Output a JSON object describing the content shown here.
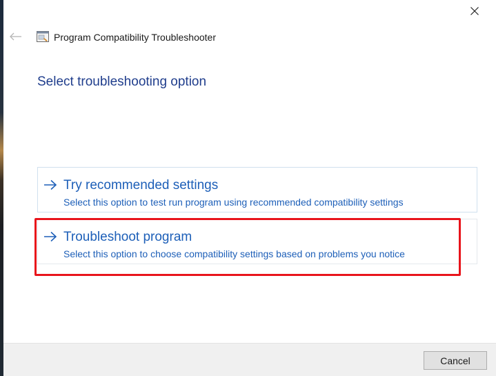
{
  "window": {
    "title": "Program Compatibility Troubleshooter",
    "close_icon": "close-icon",
    "back_icon": "back-arrow-icon",
    "app_icon": "troubleshooter-app-icon"
  },
  "page": {
    "heading": "Select troubleshooting option"
  },
  "options": [
    {
      "icon": "arrow-right-icon",
      "title": "Try recommended settings",
      "description": "Select this option to test run program using recommended compatibility settings"
    },
    {
      "icon": "arrow-right-icon",
      "title": "Troubleshoot program",
      "description": "Select this option to choose compatibility settings based on problems you notice",
      "highlighted": true
    }
  ],
  "footer": {
    "cancel_label": "Cancel"
  },
  "colors": {
    "accent_link": "#1d5fb8",
    "heading": "#1f3d8c",
    "highlight": "#e8141b",
    "footer_bg": "#f0f0f0"
  }
}
